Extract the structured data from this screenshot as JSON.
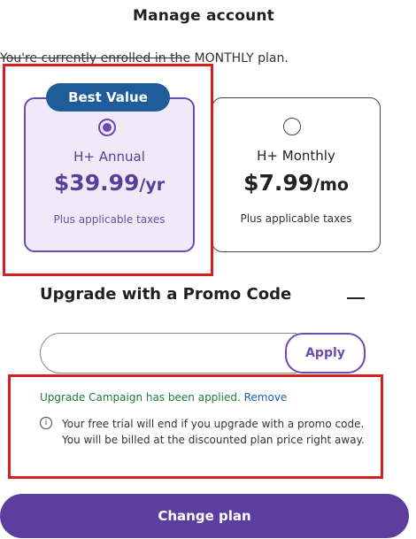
{
  "header": {
    "title": "Manage account"
  },
  "enrollment": {
    "struck_text": "You're currently enrolled in th",
    "rest_text": "e MONTHLY plan."
  },
  "plans": {
    "badge": "Best Value",
    "annual": {
      "name": "H+ Annual",
      "price": "$39.99",
      "unit": "/yr",
      "taxes": "Plus applicable taxes",
      "selected": true
    },
    "monthly": {
      "name": "H+ Monthly",
      "price": "$7.99",
      "unit": "/mo",
      "taxes": "Plus applicable taxes",
      "selected": false
    }
  },
  "promo": {
    "title": "Upgrade with a Promo Code",
    "input_value": "",
    "apply_label": "Apply",
    "applied_text": "Upgrade Campaign has been applied.",
    "remove_label": "Remove",
    "info_glyph": "i",
    "notice": "Your free trial will end if you upgrade with a promo code. You will be billed at the discounted plan price right away."
  },
  "actions": {
    "change_plan_label": "Change plan"
  },
  "colors": {
    "accent": "#5c3e9e",
    "badge": "#1f5c9a",
    "annotation": "#d61f1f"
  }
}
